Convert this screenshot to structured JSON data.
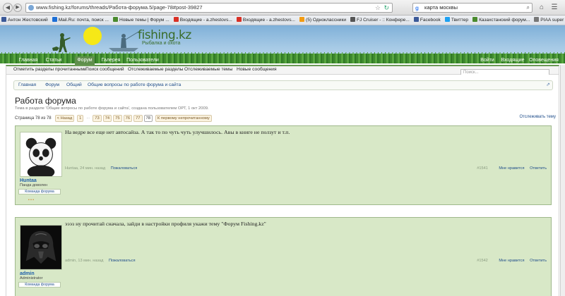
{
  "browser": {
    "url": "www.fishing.kz/forums/threads/Работа-форума.5/page-78#post-39827",
    "search_query": "карта москвы",
    "bookmarks": [
      {
        "label": "Антон Жестовский",
        "color": "#3b5998"
      },
      {
        "label": "Mail.Ru: почта, поиск ...",
        "color": "#1d6fd6"
      },
      {
        "label": "Новые темы | Форум ...",
        "color": "#4a8a2d"
      },
      {
        "label": "Входящие - a.zhestovs...",
        "color": "#d93025"
      },
      {
        "label": "Входящие - a.zhestovs...",
        "color": "#d93025"
      },
      {
        "label": "(5) Одноклассники",
        "color": "#f39c12"
      },
      {
        "label": "FJ Cruiser - :: Конфере...",
        "color": "#555555"
      },
      {
        "label": "Facebook",
        "color": "#3b5998"
      },
      {
        "label": "Твиттер",
        "color": "#1da1f2"
      },
      {
        "label": "Казахстанский форум...",
        "color": "#4a8a2d"
      },
      {
        "label": "PIAA super white mirr...",
        "color": "#777777"
      }
    ]
  },
  "site": {
    "logo_name": "fishing.kz",
    "logo_tagline": "Рыбалка и охота",
    "nav": [
      "Главная",
      "Статьи",
      "Форум",
      "Галерея",
      "Пользователи"
    ],
    "nav_active": "Форум",
    "nav_right": [
      "Войти",
      "Входящие",
      "Оповещения"
    ],
    "subnav": [
      "Отметить разделы прочитанными",
      "Поиск сообщений",
      "Отслеживаемые разделы",
      "Отслеживаемые темы",
      "Новые сообщения"
    ],
    "search_placeholder": "Поиск..."
  },
  "breadcrumb": [
    "Главная",
    "Форум",
    "Общий",
    "Общие вопросы по работе форума и сайта"
  ],
  "thread": {
    "title": "Работа форума",
    "description": "Тема в разделе 'Общие вопросы по работе форума и сайта', создана пользователем ОРТ, 1 окт 2009.",
    "page_label": "Страница 78 из 78",
    "prev": "< Назад",
    "pages": [
      "1",
      "...",
      "73",
      "74",
      "75",
      "76",
      "77",
      "78"
    ],
    "current_page": "78",
    "first_unread": "К первому непрочитанному",
    "watch": "Отслеживать тему"
  },
  "posts": [
    {
      "author": "Huntaa",
      "role": "Панда доволен",
      "badge": "Команда форума",
      "message": "На ведре все еще нет автосайза. А так то по чуть чуть улучшилось. Авы в книге не ползут и т.п.",
      "time": "Huntaa, 24 мин. назад",
      "complain": "Пожаловаться",
      "number": "#1541",
      "like": "Мне нравится",
      "reply": "Ответить"
    },
    {
      "author": "admin",
      "role": "Administrator",
      "badge": "Команда форума",
      "message": "эээз ну прочитай сначала, зайди в настройки профиля укажи тему \"Форум Fishing.kz\"",
      "time": "admin, 13 мин. назад",
      "complain": "Пожаловаться",
      "number": "#1542",
      "like": "Мне нравится",
      "reply": "Ответить"
    }
  ]
}
